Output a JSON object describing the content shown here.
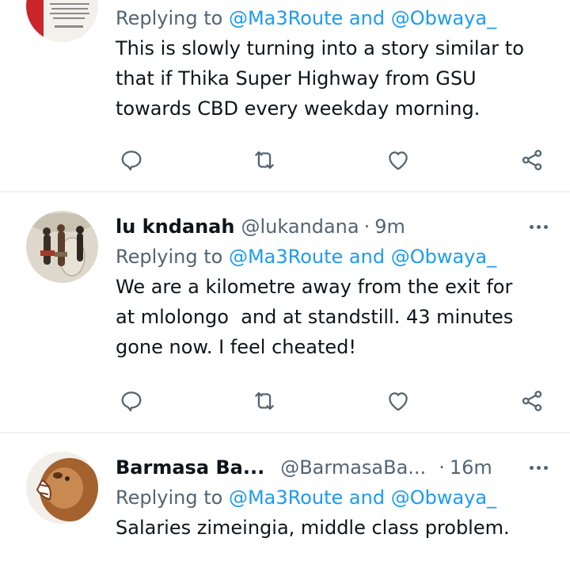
{
  "tweets": [
    {
      "reply_prefix": "Replying to ",
      "reply_to": "@Ma3Route and @Obwaya_",
      "text": "This is slowly turning into a story similar to\nthat if Thika Super Highway from GSU\ntowards CBD every weekday morning.",
      "avatar_icon": "quote-poster-avatar"
    },
    {
      "name": "lu kndanah",
      "handle": "@lukandana",
      "separator": "·",
      "time": "9m",
      "reply_prefix": "Replying to ",
      "reply_to": "@Ma3Route and @Obwaya_",
      "text": "We are a kilometre away from the exit for\nat mlolongo  and at standstill. 43 minutes\ngone now. I feel cheated!",
      "avatar_icon": "tribal-dancers-avatar"
    },
    {
      "name": "Barmasa Ba...",
      "handle": "@BarmasaBa...",
      "separator": "·",
      "time": "16m",
      "reply_prefix": "Replying to ",
      "reply_to": "@Ma3Route and @Obwaya_",
      "text": "Salaries zimeingia, middle class problem.",
      "avatar_icon": "roaring-lion-avatar"
    }
  ],
  "actions": [
    "reply-icon",
    "retweet-icon",
    "like-icon",
    "share-icon"
  ],
  "colors": {
    "accent": "#1d9bf0",
    "secondary_text": "#536471",
    "primary_text": "#0f1419",
    "divider": "#eff3f4"
  }
}
